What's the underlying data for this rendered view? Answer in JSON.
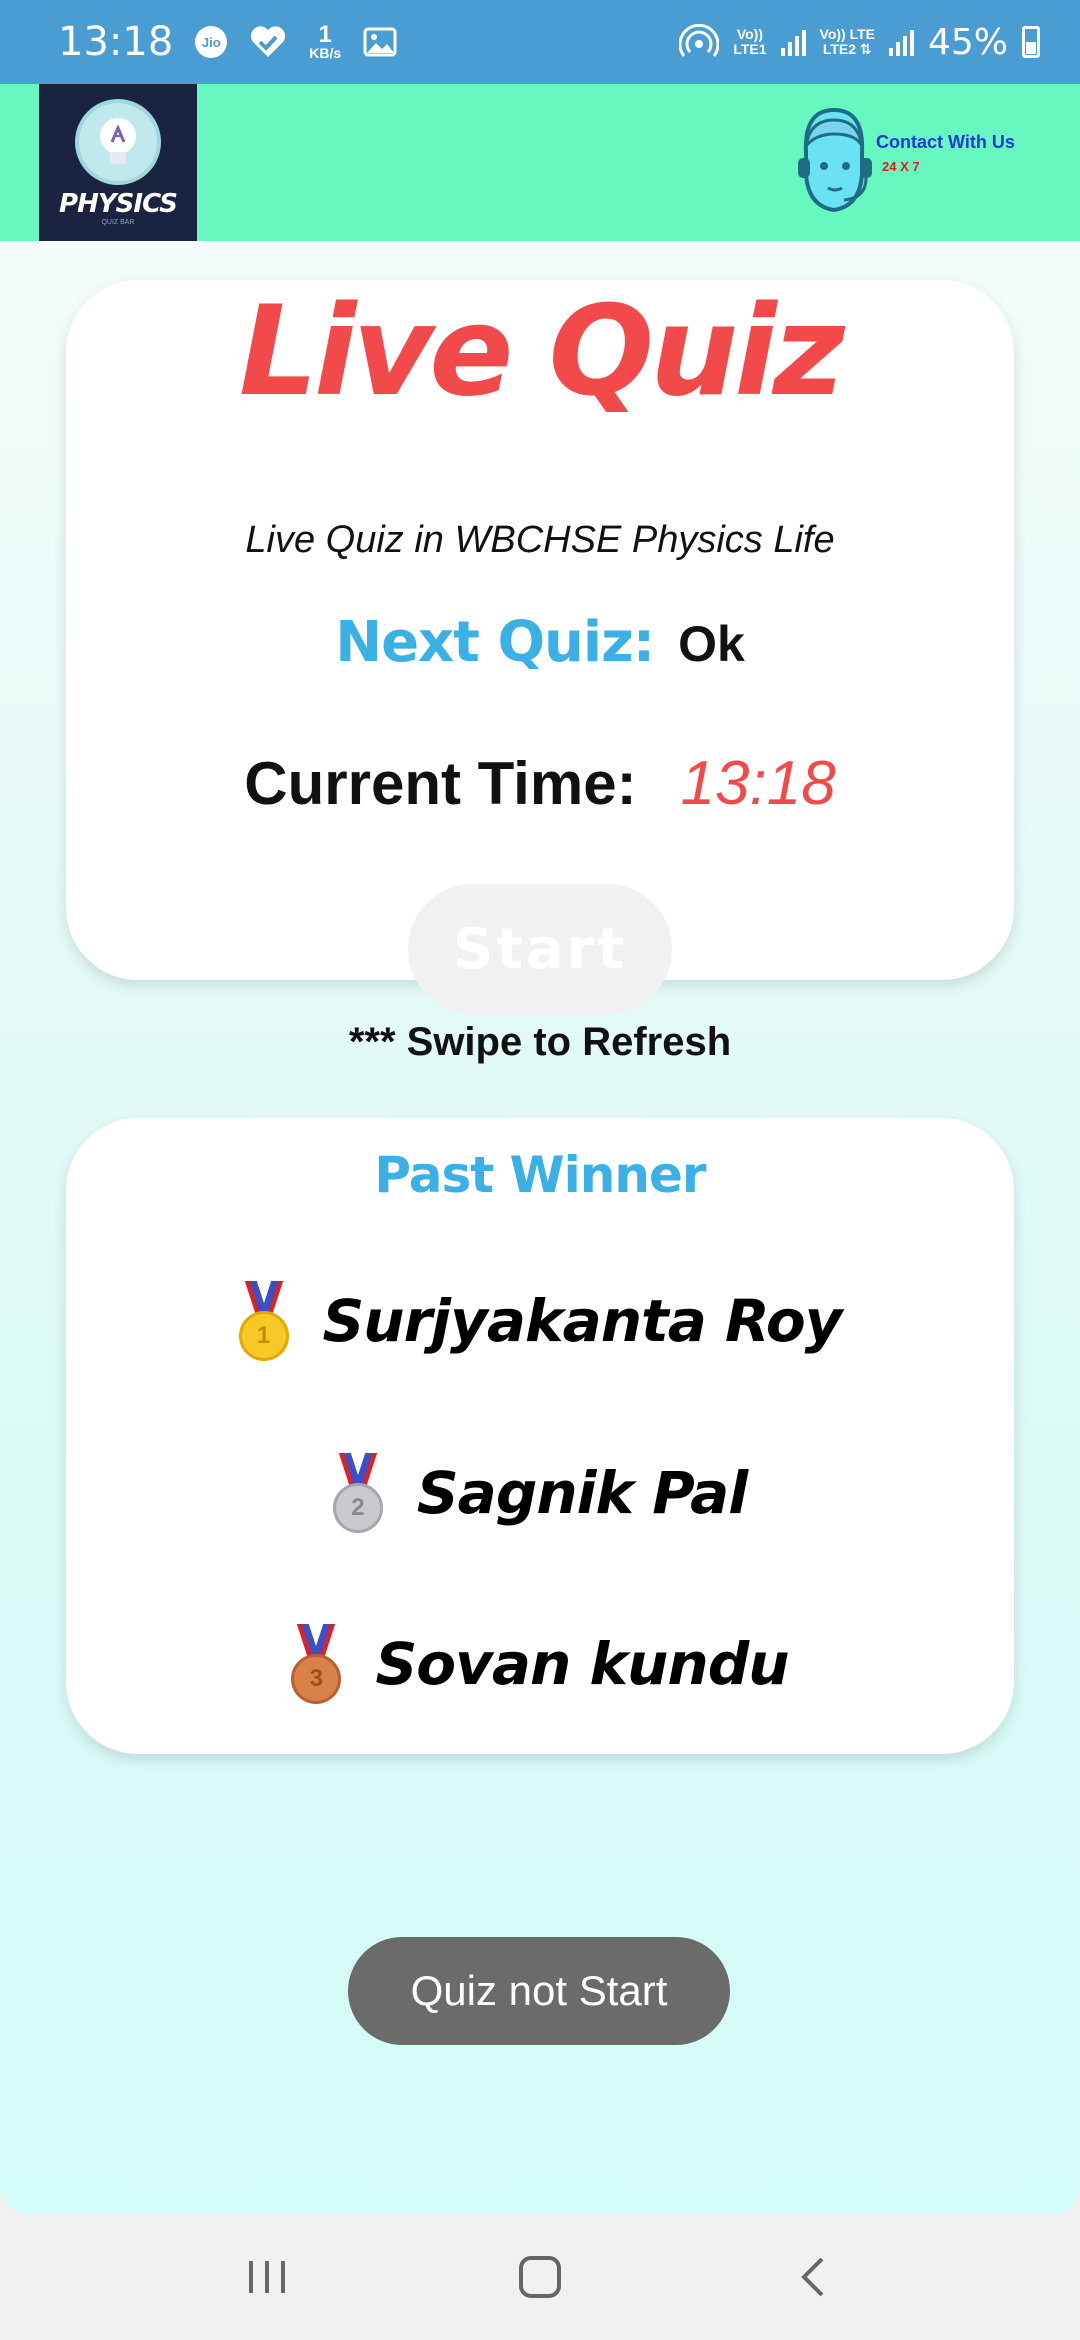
{
  "status_bar": {
    "time": "13:18",
    "carrier_icon": "Jio",
    "speed_value": "1",
    "speed_unit": "KB/s",
    "net1": "Vo))\nLTE1",
    "net2": "Vo)) LTE\nLTE2",
    "battery": "45%"
  },
  "header": {
    "logo_text": "PHYSICS",
    "logo_sub": "QUIZ BAR",
    "contact_title": "Contact With Us",
    "contact_sub": "24 X 7"
  },
  "quiz_card": {
    "title": "Live Quiz",
    "subtitle": "Live Quiz in WBCHSE Physics Life",
    "next_label": "Next Quiz:",
    "next_value": "Ok",
    "time_label": "Current Time:",
    "time_value": "13:18",
    "start_label": "Start"
  },
  "swipe_hint": "*** Swipe to Refresh",
  "winners_card": {
    "title": "Past Winner",
    "winners": [
      {
        "rank": "1",
        "name": "Surjyakanta Roy"
      },
      {
        "rank": "2",
        "name": "Sagnik Pal"
      },
      {
        "rank": "3",
        "name": "Sovan kundu"
      }
    ]
  },
  "toast": "Quiz not Start",
  "colors": {
    "status_bar": "#4a9dd3",
    "header": "#66f8bf",
    "accent_red": "#f24a4a",
    "accent_blue": "#3ab0e6"
  },
  "nav": {
    "recents_icon": "recents-icon",
    "home_icon": "home-icon",
    "back_icon": "back-icon"
  }
}
